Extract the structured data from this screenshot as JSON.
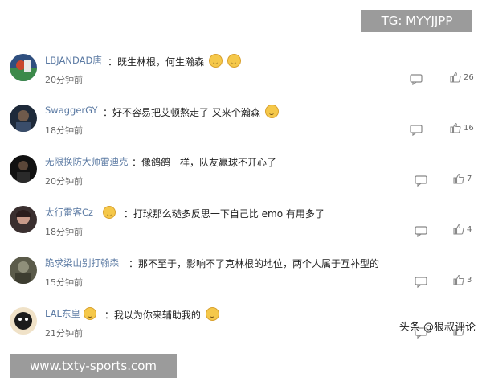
{
  "overlays": {
    "tg_text": "TG: MYYJJPP",
    "url_text": "www.txty-sports.com",
    "watermark": "头条 @狠叔评论"
  },
  "comments": [
    {
      "username": "LBJANDAD唐",
      "text": "：既生林根，何生瀚森",
      "time": "20分钟前",
      "likes": "26",
      "emoji_after": 2
    },
    {
      "username": "SwaggerGY",
      "text": "：好不容易把艾顿熬走了 又来个瀚森",
      "time": "18分钟前",
      "likes": "16",
      "emoji_after": 1
    },
    {
      "username": "无限换防大师雷迪克",
      "text": "：像鸽鸽一样，队友赢球不开心了",
      "time": "20分钟前",
      "likes": "7",
      "emoji_after": 0
    },
    {
      "username": "太行雷客Cz",
      "text": "：打球那么糙多反思一下自己比 emo 有用多了",
      "time": "18分钟前",
      "likes": "4",
      "emoji_after": 0
    },
    {
      "username": "跪求梁山别打翰森",
      "text": "：那不至于，影响不了克林根的地位，两个人属于互补型的",
      "time": "15分钟前",
      "likes": "3",
      "emoji_after": 0
    },
    {
      "username": "LAL东皇",
      "text": "：我以为你来辅助我的",
      "time": "21分钟前",
      "likes": "",
      "emoji_after": 1
    }
  ]
}
